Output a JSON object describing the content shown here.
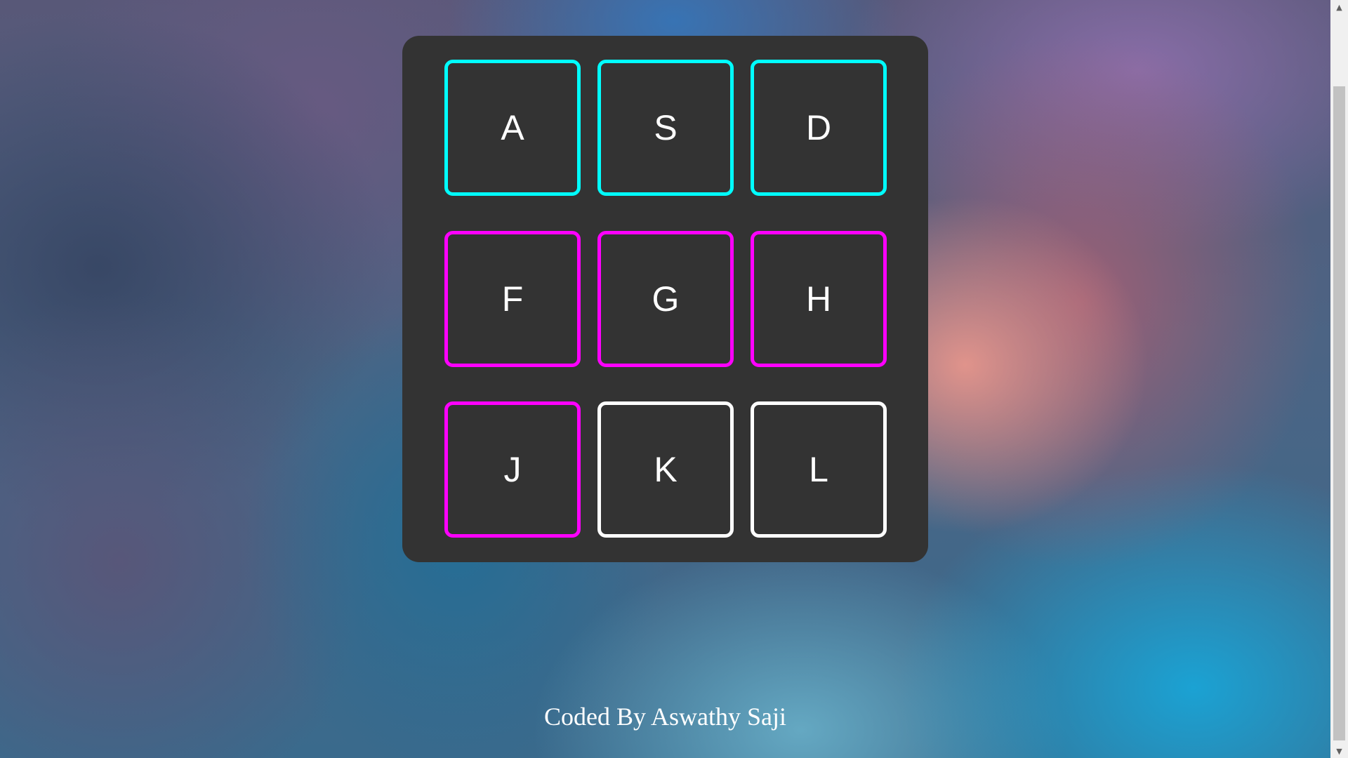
{
  "keys": [
    {
      "id": "a",
      "label": "A",
      "color": "#00ffff"
    },
    {
      "id": "s",
      "label": "S",
      "color": "#00ffff"
    },
    {
      "id": "d",
      "label": "D",
      "color": "#00ffff"
    },
    {
      "id": "f",
      "label": "F",
      "color": "#ff00ff"
    },
    {
      "id": "g",
      "label": "G",
      "color": "#ff00ff"
    },
    {
      "id": "h",
      "label": "H",
      "color": "#ff00ff"
    },
    {
      "id": "j",
      "label": "J",
      "color": "#ff00ff"
    },
    {
      "id": "k",
      "label": "K",
      "color": "#ffffff"
    },
    {
      "id": "l",
      "label": "L",
      "color": "#ffffff"
    }
  ],
  "footer": {
    "text": "Coded By Aswathy Saji"
  },
  "colors": {
    "panel": "#333333",
    "cyan": "#00ffff",
    "magenta": "#ff00ff",
    "white": "#ffffff"
  },
  "scrollbar": {
    "up_icon": "arrow-up-icon",
    "down_icon": "arrow-down-icon"
  }
}
